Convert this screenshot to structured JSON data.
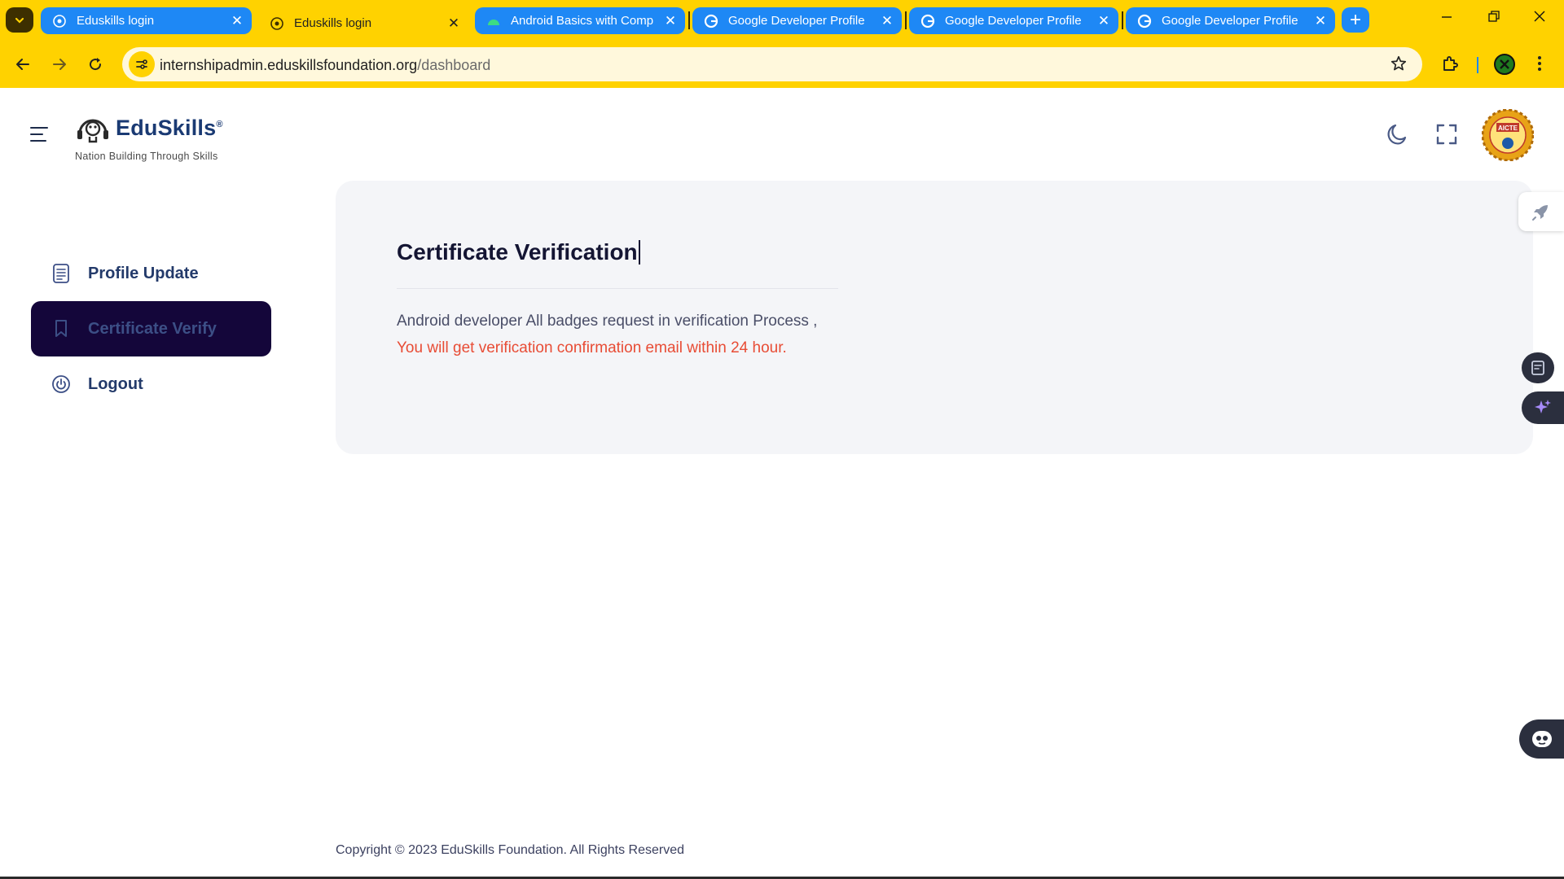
{
  "browser": {
    "tabs": [
      {
        "title": "Eduskills login",
        "state": "blue",
        "icon": "eduskills-favicon"
      },
      {
        "title": "Eduskills login",
        "state": "active",
        "icon": "eduskills-favicon"
      },
      {
        "title": "Android Basics with Comp",
        "state": "blue",
        "icon": "android-favicon"
      },
      {
        "title": "Google Developer Profile",
        "state": "blue",
        "icon": "google-favicon"
      },
      {
        "title": "Google Developer Profile",
        "state": "blue",
        "icon": "google-favicon"
      },
      {
        "title": "Google Developer Profile",
        "state": "blue",
        "icon": "google-favicon"
      }
    ],
    "url_host": "internshipadmin.eduskillsfoundation.org",
    "url_path": "/dashboard",
    "colors": {
      "chrome": "#ffd200",
      "tab_blue": "#1e88f5",
      "dark": "#3d2f00"
    }
  },
  "header": {
    "logo_name": "EduSkills",
    "logo_registered": "®",
    "logo_tagline": "Nation Building Through Skills",
    "partner_badge_text": "AICTE"
  },
  "sidebar": {
    "items": [
      {
        "label": "Profile Update",
        "icon": "document-list-icon",
        "active": false
      },
      {
        "label": "Certificate Verify",
        "icon": "bookmark-icon",
        "active": true
      },
      {
        "label": "Logout",
        "icon": "power-icon",
        "active": false
      }
    ],
    "active_bg": "#14063a"
  },
  "main": {
    "title": "Certificate Verification",
    "message_line1": "Android developer All badges request in verification Process ,",
    "message_line2": "You will get verification confirmation email within 24 hour.",
    "highlight_color": "#e84c35"
  },
  "footer": {
    "copyright": "Copyright © 2023 EduSkills Foundation. All Rights Reserved"
  }
}
